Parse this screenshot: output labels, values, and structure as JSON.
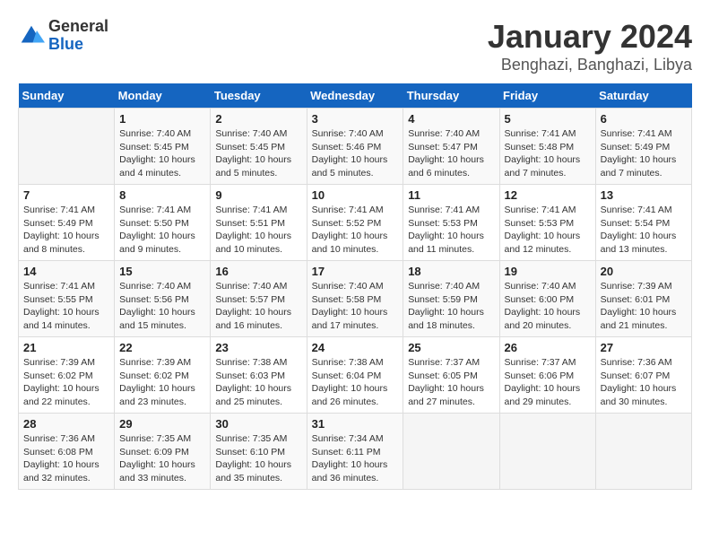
{
  "header": {
    "logo_general": "General",
    "logo_blue": "Blue",
    "month_title": "January 2024",
    "location": "Benghazi, Banghazi, Libya"
  },
  "calendar": {
    "days_of_week": [
      "Sunday",
      "Monday",
      "Tuesday",
      "Wednesday",
      "Thursday",
      "Friday",
      "Saturday"
    ],
    "weeks": [
      [
        {
          "day": "",
          "info": ""
        },
        {
          "day": "1",
          "info": "Sunrise: 7:40 AM\nSunset: 5:45 PM\nDaylight: 10 hours\nand 4 minutes."
        },
        {
          "day": "2",
          "info": "Sunrise: 7:40 AM\nSunset: 5:45 PM\nDaylight: 10 hours\nand 5 minutes."
        },
        {
          "day": "3",
          "info": "Sunrise: 7:40 AM\nSunset: 5:46 PM\nDaylight: 10 hours\nand 5 minutes."
        },
        {
          "day": "4",
          "info": "Sunrise: 7:40 AM\nSunset: 5:47 PM\nDaylight: 10 hours\nand 6 minutes."
        },
        {
          "day": "5",
          "info": "Sunrise: 7:41 AM\nSunset: 5:48 PM\nDaylight: 10 hours\nand 7 minutes."
        },
        {
          "day": "6",
          "info": "Sunrise: 7:41 AM\nSunset: 5:49 PM\nDaylight: 10 hours\nand 7 minutes."
        }
      ],
      [
        {
          "day": "7",
          "info": "Sunrise: 7:41 AM\nSunset: 5:49 PM\nDaylight: 10 hours\nand 8 minutes."
        },
        {
          "day": "8",
          "info": "Sunrise: 7:41 AM\nSunset: 5:50 PM\nDaylight: 10 hours\nand 9 minutes."
        },
        {
          "day": "9",
          "info": "Sunrise: 7:41 AM\nSunset: 5:51 PM\nDaylight: 10 hours\nand 10 minutes."
        },
        {
          "day": "10",
          "info": "Sunrise: 7:41 AM\nSunset: 5:52 PM\nDaylight: 10 hours\nand 10 minutes."
        },
        {
          "day": "11",
          "info": "Sunrise: 7:41 AM\nSunset: 5:53 PM\nDaylight: 10 hours\nand 11 minutes."
        },
        {
          "day": "12",
          "info": "Sunrise: 7:41 AM\nSunset: 5:53 PM\nDaylight: 10 hours\nand 12 minutes."
        },
        {
          "day": "13",
          "info": "Sunrise: 7:41 AM\nSunset: 5:54 PM\nDaylight: 10 hours\nand 13 minutes."
        }
      ],
      [
        {
          "day": "14",
          "info": "Sunrise: 7:41 AM\nSunset: 5:55 PM\nDaylight: 10 hours\nand 14 minutes."
        },
        {
          "day": "15",
          "info": "Sunrise: 7:40 AM\nSunset: 5:56 PM\nDaylight: 10 hours\nand 15 minutes."
        },
        {
          "day": "16",
          "info": "Sunrise: 7:40 AM\nSunset: 5:57 PM\nDaylight: 10 hours\nand 16 minutes."
        },
        {
          "day": "17",
          "info": "Sunrise: 7:40 AM\nSunset: 5:58 PM\nDaylight: 10 hours\nand 17 minutes."
        },
        {
          "day": "18",
          "info": "Sunrise: 7:40 AM\nSunset: 5:59 PM\nDaylight: 10 hours\nand 18 minutes."
        },
        {
          "day": "19",
          "info": "Sunrise: 7:40 AM\nSunset: 6:00 PM\nDaylight: 10 hours\nand 20 minutes."
        },
        {
          "day": "20",
          "info": "Sunrise: 7:39 AM\nSunset: 6:01 PM\nDaylight: 10 hours\nand 21 minutes."
        }
      ],
      [
        {
          "day": "21",
          "info": "Sunrise: 7:39 AM\nSunset: 6:02 PM\nDaylight: 10 hours\nand 22 minutes."
        },
        {
          "day": "22",
          "info": "Sunrise: 7:39 AM\nSunset: 6:02 PM\nDaylight: 10 hours\nand 23 minutes."
        },
        {
          "day": "23",
          "info": "Sunrise: 7:38 AM\nSunset: 6:03 PM\nDaylight: 10 hours\nand 25 minutes."
        },
        {
          "day": "24",
          "info": "Sunrise: 7:38 AM\nSunset: 6:04 PM\nDaylight: 10 hours\nand 26 minutes."
        },
        {
          "day": "25",
          "info": "Sunrise: 7:37 AM\nSunset: 6:05 PM\nDaylight: 10 hours\nand 27 minutes."
        },
        {
          "day": "26",
          "info": "Sunrise: 7:37 AM\nSunset: 6:06 PM\nDaylight: 10 hours\nand 29 minutes."
        },
        {
          "day": "27",
          "info": "Sunrise: 7:36 AM\nSunset: 6:07 PM\nDaylight: 10 hours\nand 30 minutes."
        }
      ],
      [
        {
          "day": "28",
          "info": "Sunrise: 7:36 AM\nSunset: 6:08 PM\nDaylight: 10 hours\nand 32 minutes."
        },
        {
          "day": "29",
          "info": "Sunrise: 7:35 AM\nSunset: 6:09 PM\nDaylight: 10 hours\nand 33 minutes."
        },
        {
          "day": "30",
          "info": "Sunrise: 7:35 AM\nSunset: 6:10 PM\nDaylight: 10 hours\nand 35 minutes."
        },
        {
          "day": "31",
          "info": "Sunrise: 7:34 AM\nSunset: 6:11 PM\nDaylight: 10 hours\nand 36 minutes."
        },
        {
          "day": "",
          "info": ""
        },
        {
          "day": "",
          "info": ""
        },
        {
          "day": "",
          "info": ""
        }
      ]
    ]
  }
}
